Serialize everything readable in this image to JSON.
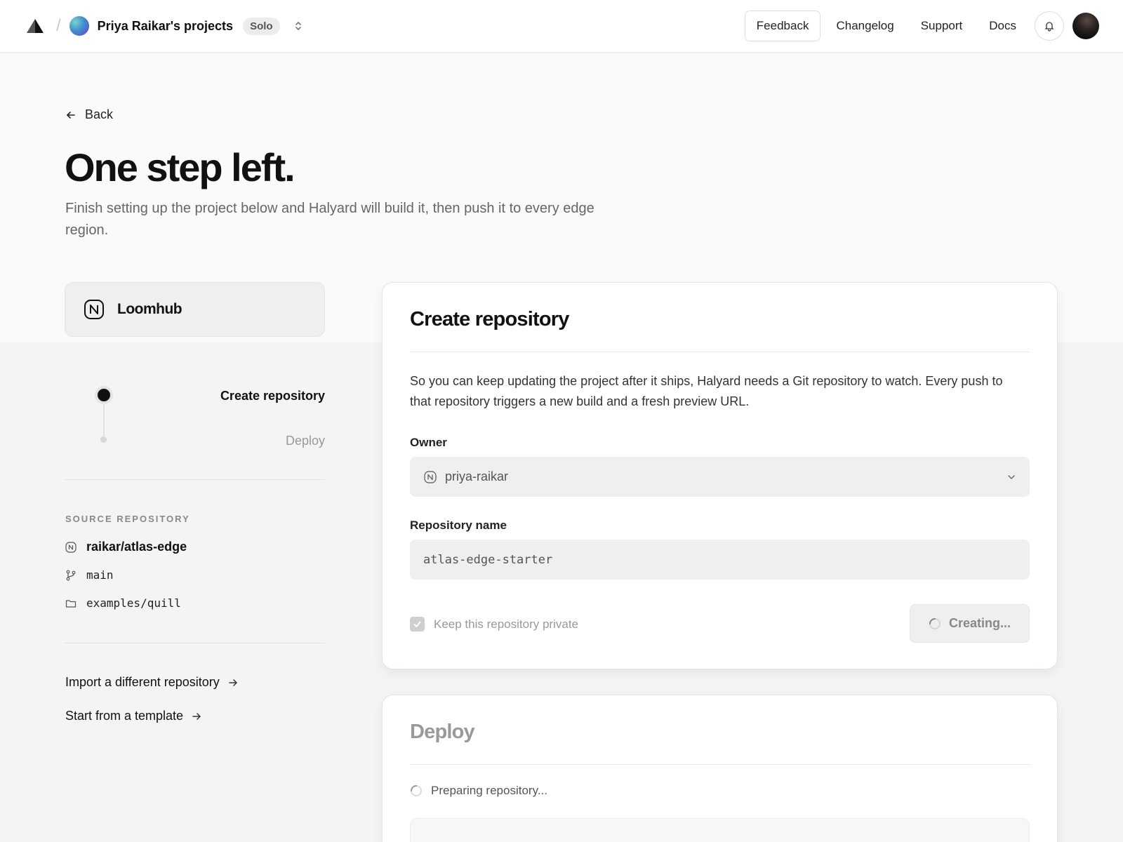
{
  "topbar": {
    "team_name": "Priya Raikar's projects",
    "plan": "Solo",
    "nav": {
      "feedback": "Feedback",
      "changelog": "Changelog",
      "support": "Support",
      "docs": "Docs"
    }
  },
  "page": {
    "back_label": "Back",
    "title": "One step left.",
    "subtitle": "Finish setting up the project below and Halyard will build it, then push it to every edge region."
  },
  "project": {
    "name": "Loomhub"
  },
  "steps": [
    {
      "label": "Create repository",
      "state": "active"
    },
    {
      "label": "Deploy",
      "state": "pending"
    }
  ],
  "source": {
    "heading": "SOURCE REPOSITORY",
    "repo": "raikar/atlas-edge",
    "branch": "main",
    "directory": "examples/quill"
  },
  "links": {
    "import_different": "Import a different repository",
    "start_template": "Start from a template"
  },
  "create_card": {
    "title": "Create repository",
    "description": "So you can keep updating the project after it ships, Halyard needs a Git repository to watch. Every push to that repository triggers a new build and a fresh preview URL.",
    "owner_label": "Owner",
    "owner_value": "priya-raikar",
    "repo_name_label": "Repository name",
    "repo_name_value": "atlas-edge-starter",
    "private_label": "Keep this repository private",
    "private_checked": true,
    "submit_label": "Creating..."
  },
  "deploy_card": {
    "title": "Deploy",
    "status": "Preparing repository..."
  },
  "colors": {
    "primary_text": "#111111",
    "muted_text": "#999999",
    "page_bg": "#f3f4f5",
    "hero_bg": "#fafafa"
  }
}
